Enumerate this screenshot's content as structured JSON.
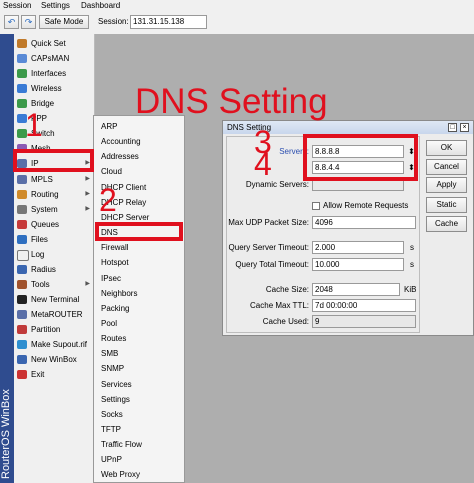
{
  "menu": {
    "session": "Session",
    "settings": "Settings",
    "dashboard": "Dashboard"
  },
  "toolbar": {
    "undo_icon": "undo-arrow",
    "redo_icon": "redo-arrow",
    "safe_mode": "Safe Mode",
    "session_label": "Session:",
    "session_value": "131.31.15.138"
  },
  "vertical_label": "RouterOS WinBox",
  "sidebar": {
    "items": [
      {
        "label": "Quick Set",
        "icon": "quickset-icon",
        "color": "#c07a2a"
      },
      {
        "label": "CAPsMAN",
        "icon": "capsman-icon",
        "color": "#5a8ad6"
      },
      {
        "label": "Interfaces",
        "icon": "interfaces-icon",
        "color": "#3c9a4a"
      },
      {
        "label": "Wireless",
        "icon": "wireless-icon",
        "color": "#3a7bd5"
      },
      {
        "label": "Bridge",
        "icon": "bridge-icon",
        "color": "#3c9a4a"
      },
      {
        "label": "PPP",
        "icon": "ppp-icon",
        "color": "#3a7bd5"
      },
      {
        "label": "Switch",
        "icon": "switch-icon",
        "color": "#3c9a4a"
      },
      {
        "label": "Mesh",
        "icon": "mesh-icon",
        "color": "#8a5ab4"
      },
      {
        "label": "IP",
        "icon": "ip-icon",
        "color": "#5a6fa8",
        "arrow": "▶"
      },
      {
        "label": "MPLS",
        "icon": "mpls-icon",
        "color": "#5a6fa8",
        "arrow": "▶"
      },
      {
        "label": "Routing",
        "icon": "routing-icon",
        "color": "#d08a2a",
        "arrow": "▶"
      },
      {
        "label": "System",
        "icon": "system-icon",
        "color": "#777777",
        "arrow": "▶"
      },
      {
        "label": "Queues",
        "icon": "queues-icon",
        "color": "#c63a3a"
      },
      {
        "label": "Files",
        "icon": "files-icon",
        "color": "#2f6fc0"
      },
      {
        "label": "Log",
        "icon": "log-icon",
        "color": "#f0f0f0"
      },
      {
        "label": "Radius",
        "icon": "radius-icon",
        "color": "#3a66b0"
      },
      {
        "label": "Tools",
        "icon": "tools-icon",
        "color": "#a0522d",
        "arrow": "▶"
      },
      {
        "label": "New Terminal",
        "icon": "terminal-icon",
        "color": "#222222"
      },
      {
        "label": "MetaROUTER",
        "icon": "metarouter-icon",
        "color": "#5a6fa8"
      },
      {
        "label": "Partition",
        "icon": "partition-icon",
        "color": "#c03a3a"
      },
      {
        "label": "Make Supout.rif",
        "icon": "supout-icon",
        "color": "#2f8fd0"
      },
      {
        "label": "New WinBox",
        "icon": "winbox-icon",
        "color": "#3a66b0"
      },
      {
        "label": "Exit",
        "icon": "exit-icon",
        "color": "#cc3333"
      }
    ]
  },
  "submenu": {
    "items": [
      "ARP",
      "Accounting",
      "Addresses",
      "Cloud",
      "DHCP Client",
      "DHCP Relay",
      "DHCP Server",
      "DNS",
      "Firewall",
      "Hotspot",
      "IPsec",
      "Neighbors",
      "Packing",
      "Pool",
      "Routes",
      "SMB",
      "SNMP",
      "Services",
      "Settings",
      "Socks",
      "TFTP",
      "Traffic Flow",
      "UPnP",
      "Web Proxy"
    ]
  },
  "dialog": {
    "title": "DNS Setting",
    "servers_label": "Servers:",
    "servers": [
      "8.8.8.8",
      "8.8.4.4"
    ],
    "dynamic_servers_label": "Dynamic Servers:",
    "allow_remote_label": "Allow Remote Requests",
    "max_udp_label": "Max UDP Packet Size:",
    "max_udp_value": "4096",
    "query_server_label": "Query Server Timeout:",
    "query_server_value": "2.000",
    "query_total_label": "Query Total Timeout:",
    "query_total_value": "10.000",
    "timeout_unit": "s",
    "cache_size_label": "Cache Size:",
    "cache_size_value": "2048",
    "cache_size_unit": "KiB",
    "cache_ttl_label": "Cache Max TTL:",
    "cache_ttl_value": "7d 00:00:00",
    "cache_used_label": "Cache Used:",
    "cache_used_value": "9",
    "buttons": {
      "ok": "OK",
      "cancel": "Cancel",
      "apply": "Apply",
      "static": "Static",
      "cache": "Cache"
    }
  },
  "annotations": {
    "headline": "DNS Setting",
    "step1": "1",
    "step2": "2",
    "step3": "3",
    "step4": "4",
    "color": "#e0101e"
  }
}
